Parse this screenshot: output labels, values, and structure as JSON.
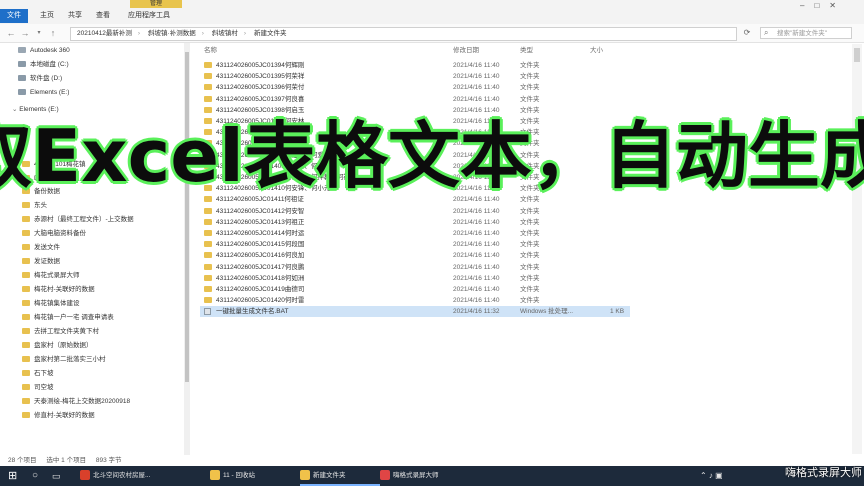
{
  "ribbon": {
    "file_tab": "文件",
    "tabs": [
      "主页",
      "共享",
      "查看",
      "应用程序工具"
    ],
    "context_label": "管理"
  },
  "address": {
    "crumbs": [
      "20210412最新补测",
      "斜坡镇·补测数据",
      "斜坡镇村",
      "新建文件夹"
    ],
    "search_placeholder": "搜索\"新建文件夹\""
  },
  "sidebar": {
    "items": [
      {
        "label": "Autodesk 360",
        "icon": "cloud-icon"
      },
      {
        "label": "本地磁盘 (C:)",
        "icon": "drive-icon"
      },
      {
        "label": "软件盘 (D:)",
        "icon": "drive-icon"
      },
      {
        "label": "Elements (E:)",
        "icon": "drive-icon"
      },
      {
        "label": "Elements (E:)",
        "icon": "drive-icon"
      },
      {
        "label": "431124101梅花镇",
        "icon": "folder-icon"
      },
      {
        "label": "DJITerra",
        "icon": "folder-icon"
      },
      {
        "label": "备份数据",
        "icon": "folder-icon"
      },
      {
        "label": "东头",
        "icon": "folder-icon"
      },
      {
        "label": "赤源村（最终工程文件）-上交数据",
        "icon": "folder-icon"
      },
      {
        "label": "大脑电脑资料备份",
        "icon": "folder-icon"
      },
      {
        "label": "发送文件",
        "icon": "folder-icon"
      },
      {
        "label": "发证数据",
        "icon": "folder-icon"
      },
      {
        "label": "梅花式录屏大师",
        "icon": "folder-icon"
      },
      {
        "label": "梅花村-关联好的数据",
        "icon": "folder-icon"
      },
      {
        "label": "梅花镇集体建设",
        "icon": "folder-icon"
      },
      {
        "label": "梅花镇一户一宅 调查申请表",
        "icon": "folder-icon"
      },
      {
        "label": "去拼工程文件夹黄下村",
        "icon": "folder-icon"
      },
      {
        "label": "盘家村（原始数据）",
        "icon": "folder-icon"
      },
      {
        "label": "盘家村第二批落实三小村",
        "icon": "folder-icon"
      },
      {
        "label": "石下坡",
        "icon": "folder-icon"
      },
      {
        "label": "司空坡",
        "icon": "folder-icon"
      },
      {
        "label": "天泰测绘-梅花上交数据20200918",
        "icon": "folder-icon"
      },
      {
        "label": "修直村-关联好的数据",
        "icon": "folder-icon"
      }
    ]
  },
  "columns": {
    "name": "名称",
    "modified": "修改日期",
    "type": "类型",
    "size": "大小"
  },
  "files": [
    {
      "name": "431124026005JC01394何辉刚",
      "date": "2021/4/16 11:40",
      "type": "文件夹",
      "size": ""
    },
    {
      "name": "431124026005JC01395何荣祥",
      "date": "2021/4/16 11:40",
      "type": "文件夹",
      "size": ""
    },
    {
      "name": "431124026005JC01396何荣付",
      "date": "2021/4/16 11:40",
      "type": "文件夹",
      "size": ""
    },
    {
      "name": "431124026005JC01397何良喜",
      "date": "2021/4/16 11:40",
      "type": "文件夹",
      "size": ""
    },
    {
      "name": "431124026005JC01398何启玉",
      "date": "2021/4/16 11:40",
      "type": "文件夹",
      "size": ""
    },
    {
      "name": "431124026005JC01404何安林",
      "date": "2021/4/16 11:40",
      "type": "文件夹",
      "size": ""
    },
    {
      "name": "431124026005JC01405何安琴",
      "date": "2021/4/16 11:40",
      "type": "文件夹",
      "size": ""
    },
    {
      "name": "431124026005JC01406何安波",
      "date": "2021/4/16 11:40",
      "type": "文件夹",
      "size": ""
    },
    {
      "name": "431124026005JC01407何建江、何爱文",
      "date": "2021/4/16 11:40",
      "type": "文件夹",
      "size": ""
    },
    {
      "name": "431124026005JC01408何安知、何安庆",
      "date": "2021/4/16 11:40",
      "type": "文件夹",
      "size": ""
    },
    {
      "name": "431124026005JC01409何神德、何神教、何神锦",
      "date": "2021/4/16 11:40",
      "type": "文件夹",
      "size": ""
    },
    {
      "name": "431124026005JC01410何安锋、何小元",
      "date": "2021/4/16 11:40",
      "type": "文件夹",
      "size": ""
    },
    {
      "name": "431124026005JC01411何祖证",
      "date": "2021/4/16 11:40",
      "type": "文件夹",
      "size": ""
    },
    {
      "name": "431124026005JC01412何安智",
      "date": "2021/4/16 11:40",
      "type": "文件夹",
      "size": ""
    },
    {
      "name": "431124026005JC01413何祖正",
      "date": "2021/4/16 11:40",
      "type": "文件夹",
      "size": ""
    },
    {
      "name": "431124026005JC01414何时运",
      "date": "2021/4/16 11:40",
      "type": "文件夹",
      "size": ""
    },
    {
      "name": "431124026005JC01415何段国",
      "date": "2021/4/16 11:40",
      "type": "文件夹",
      "size": ""
    },
    {
      "name": "431124026005JC01416何良加",
      "date": "2021/4/16 11:40",
      "type": "文件夹",
      "size": ""
    },
    {
      "name": "431124026005JC01417何良鹏",
      "date": "2021/4/16 11:40",
      "type": "文件夹",
      "size": ""
    },
    {
      "name": "431124026005JC01418何如洲",
      "date": "2021/4/16 11:40",
      "type": "文件夹",
      "size": ""
    },
    {
      "name": "431124026005JC01419曲德司",
      "date": "2021/4/16 11:40",
      "type": "文件夹",
      "size": ""
    },
    {
      "name": "431124026005JC01420何时雷",
      "date": "2021/4/16 11:40",
      "type": "文件夹",
      "size": ""
    },
    {
      "name": "一键批量生成文件名.BAT",
      "date": "2021/4/16 11:32",
      "type": "Windows 批处理...",
      "size": "1 KB"
    }
  ],
  "status": {
    "count": "28 个项目",
    "selected": "选中 1 个项目",
    "size": "893 字节"
  },
  "taskbar": {
    "items": [
      {
        "label": "北斗空间农村房屋...",
        "color": "#d9402b"
      },
      {
        "label": "11 - 回收站",
        "color": "#f0c24a"
      },
      {
        "label": "新建文件夹",
        "color": "#f0c24a"
      },
      {
        "label": "嗨格式录屏大师",
        "color": "#e04545"
      }
    ]
  },
  "watermark": "嗨格式录屏大师",
  "caption": "取Excel表格文本，自动生成",
  "colors": {
    "accent": "#1e6fc9",
    "caption_outline": "#5af05a",
    "taskbar": "#1d2a3b",
    "folder": "#e8c14f"
  }
}
